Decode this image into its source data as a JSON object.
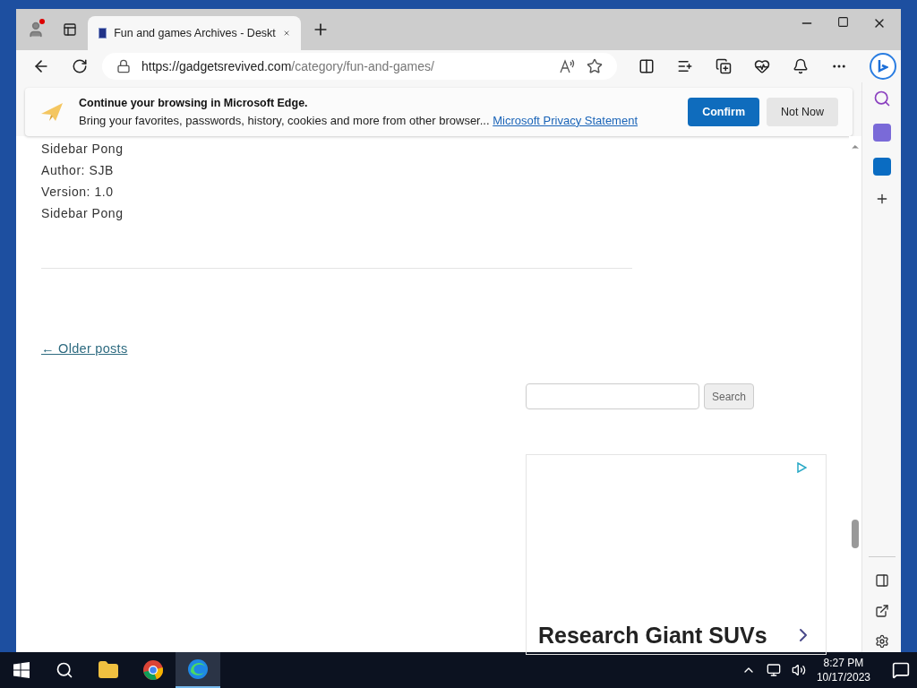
{
  "tab": {
    "title": "Fun and games Archives - Deskt",
    "selected": true
  },
  "address": {
    "url_host": "https://gadgetsrevived.com",
    "url_path": "/category/fun-and-games/"
  },
  "infobar": {
    "title": "Continue your browsing in Microsoft Edge.",
    "body": "Bring your favorites, passwords, history, cookies and more from other browser...",
    "link": "Microsoft Privacy Statement",
    "buttons": [
      {
        "label": "Confirm",
        "kind": "primary"
      },
      {
        "label": "Not Now",
        "kind": "secondary"
      }
    ]
  },
  "post_lines": [
    "Sidebar Pong",
    "Author: SJB",
    "Version: 1.0",
    "Sidebar Pong"
  ],
  "older_posts": "← Older posts",
  "search": {
    "button": "Search"
  },
  "ad": {
    "headline": "Research Giant SUVs"
  },
  "taskbar": {
    "apps": [
      {
        "kind": "explorer",
        "selected": false
      },
      {
        "kind": "chrome",
        "selected": false
      },
      {
        "kind": "edge",
        "selected": true
      }
    ],
    "time": "8:27 PM",
    "date": "10/17/2023"
  }
}
